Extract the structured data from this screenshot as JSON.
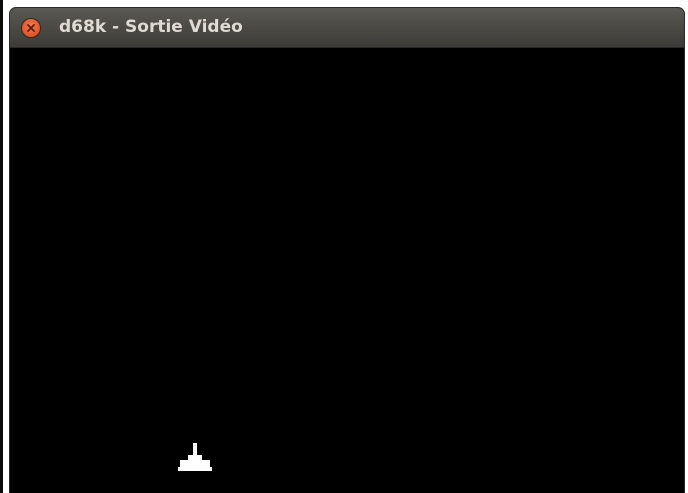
{
  "window": {
    "title": "d68k - Sortie Vidéo",
    "close_icon": "close-icon",
    "close_button_color": "#e25a2f",
    "titlebar_color": "#4a4843",
    "title_color": "#dfdbd2"
  },
  "video_output": {
    "background_color": "#000000",
    "sprite_icon": "player-ship-icon",
    "sprite_color": "#ffffff"
  }
}
